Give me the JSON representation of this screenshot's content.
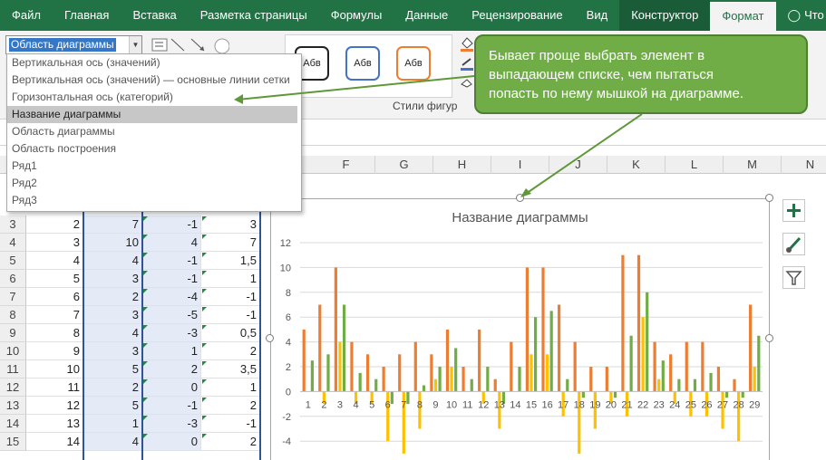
{
  "ribbon_tabs": [
    {
      "label": "Файл"
    },
    {
      "label": "Главная"
    },
    {
      "label": "Вставка"
    },
    {
      "label": "Разметка страницы"
    },
    {
      "label": "Формулы"
    },
    {
      "label": "Данные"
    },
    {
      "label": "Рецензирование"
    },
    {
      "label": "Вид"
    },
    {
      "label": "Конструктор"
    },
    {
      "label": "Формат"
    },
    {
      "label": "Что вы"
    }
  ],
  "format_ribbon": {
    "element_selector_value": "Область диаграммы",
    "shape_style_sample": "Абв",
    "shape_styles_group_label": "Стили фигур"
  },
  "element_dropdown": {
    "items": [
      "Вертикальная ось (значений)",
      "Вертикальная ось (значений) — основные линии сетки",
      "Горизонтальная ось (категорий)",
      "Название диаграммы",
      "Область диаграммы",
      "Область построения",
      "Ряд1",
      "Ряд2",
      "Ряд3"
    ],
    "selected_index": 3
  },
  "callout": {
    "lines": [
      "Бывает проще выбрать элемент в",
      "выпадающем списке, чем пытаться",
      "попасть по нему мышкой на диаграмме."
    ],
    "color": "#70ad47"
  },
  "sheet": {
    "columns": [
      "F",
      "G",
      "H",
      "I",
      "J",
      "K",
      "L",
      "M",
      "N"
    ],
    "rows": [
      {
        "num": "3",
        "a": "2",
        "b": "7",
        "c": "-1",
        "d": "3"
      },
      {
        "num": "4",
        "a": "3",
        "b": "10",
        "c": "4",
        "d": "7"
      },
      {
        "num": "5",
        "a": "4",
        "b": "4",
        "c": "-1",
        "d": "1,5"
      },
      {
        "num": "6",
        "a": "5",
        "b": "3",
        "c": "-1",
        "d": "1"
      },
      {
        "num": "7",
        "a": "6",
        "b": "2",
        "c": "-4",
        "d": "-1"
      },
      {
        "num": "8",
        "a": "7",
        "b": "3",
        "c": "-5",
        "d": "-1"
      },
      {
        "num": "9",
        "a": "8",
        "b": "4",
        "c": "-3",
        "d": "0,5"
      },
      {
        "num": "10",
        "a": "9",
        "b": "3",
        "c": "1",
        "d": "2"
      },
      {
        "num": "11",
        "a": "10",
        "b": "5",
        "c": "2",
        "d": "3,5"
      },
      {
        "num": "12",
        "a": "11",
        "b": "2",
        "c": "0",
        "d": "1"
      },
      {
        "num": "13",
        "a": "12",
        "b": "5",
        "c": "-1",
        "d": "2"
      },
      {
        "num": "14",
        "a": "13",
        "b": "1",
        "c": "-3",
        "d": "-1"
      },
      {
        "num": "15",
        "a": "14",
        "b": "4",
        "c": "0",
        "d": "2"
      }
    ]
  },
  "chart_data": {
    "type": "bar",
    "title": "Название диаграммы",
    "categories": [
      "1",
      "2",
      "3",
      "4",
      "5",
      "6",
      "7",
      "8",
      "9",
      "10",
      "11",
      "12",
      "13",
      "14",
      "15",
      "16",
      "17",
      "18",
      "19",
      "20",
      "21",
      "22",
      "23",
      "24",
      "25",
      "26",
      "27",
      "28",
      "29"
    ],
    "ylim": [
      -4,
      12
    ],
    "yticks": [
      "12",
      "10",
      "8",
      "6",
      "4",
      "2",
      "0",
      "-2",
      "-4"
    ],
    "grid": true,
    "series": [
      {
        "color": "#ed7d31",
        "values": [
          5,
          7,
          10,
          4,
          3,
          2,
          3,
          4,
          3,
          5,
          2,
          5,
          1,
          4,
          10,
          10,
          7,
          4,
          2,
          2,
          11,
          11,
          4,
          3,
          4,
          4,
          2,
          1,
          7
        ]
      },
      {
        "color": "#ffc000",
        "values": [
          0,
          -1,
          4,
          -1,
          -1,
          -4,
          -5,
          -3,
          1,
          2,
          0,
          -1,
          -3,
          0,
          3,
          3,
          -2,
          -5,
          -3,
          -1,
          -2,
          6,
          1,
          -1,
          -2,
          -2,
          -3,
          -4,
          2
        ]
      },
      {
        "color": "#70ad47",
        "values": [
          2.5,
          3,
          7,
          1.5,
          1,
          -1,
          -1,
          0.5,
          2,
          3.5,
          1,
          2,
          -1,
          2,
          6,
          6.5,
          1,
          -0.5,
          0,
          -0.5,
          4.5,
          8,
          2.5,
          1,
          1,
          1.5,
          -0.5,
          -0.5,
          4.5
        ]
      }
    ]
  }
}
